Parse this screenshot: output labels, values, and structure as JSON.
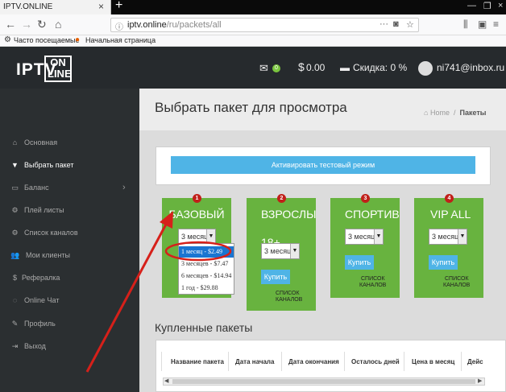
{
  "browser": {
    "tab_title": "IPTV.ONLINE",
    "url_host": "iptv.online",
    "url_path": "/ru/packets/all",
    "bookmarks": [
      "Часто посещаемые",
      "Начальная страница"
    ]
  },
  "header": {
    "logo_main": "IPTV",
    "logo_on": "ON",
    "logo_line": "LINE",
    "mail_count": "0",
    "balance": "0.00",
    "discount": "Скидка: 0 %",
    "email": "ni741@inbox.ru"
  },
  "sidebar": {
    "items": [
      {
        "icon": "home-icon",
        "label": "Основная"
      },
      {
        "icon": "cart-icon",
        "label": "Выбрать пакет"
      },
      {
        "icon": "card-icon",
        "label": "Баланс"
      },
      {
        "icon": "gear-icon",
        "label": "Плей листы"
      },
      {
        "icon": "gear-icon",
        "label": "Список каналов"
      },
      {
        "icon": "users-icon",
        "label": "Мои клиенты"
      },
      {
        "icon": "dollar-icon",
        "label": "Рефералка"
      },
      {
        "icon": "chat-icon",
        "label": "Online Чат"
      },
      {
        "icon": "edit-icon",
        "label": "Профиль"
      },
      {
        "icon": "logout-icon",
        "label": "Выход"
      }
    ]
  },
  "main": {
    "title": "Выбрать пакет для просмотра",
    "breadcrumb_home": "Home",
    "breadcrumb_sep": "/",
    "breadcrumb_current": "Пакеты",
    "test_button": "Активировать тестовый режим",
    "packages": [
      {
        "num": "1",
        "name": "БАЗОВЫЙ",
        "select": "3 месяца",
        "buy": "Купить",
        "channels": "СПИСОК КАНАЛОВ"
      },
      {
        "num": "2",
        "name": "ВЗРОСЛЫЙ",
        "name2": "18+",
        "select": "3 месяца",
        "buy": "Купить",
        "channels1": "СПИСОК",
        "channels2": "КАНАЛОВ"
      },
      {
        "num": "3",
        "name": "СПОРТИВНЫЙ",
        "select": "3 месяца",
        "buy": "Купить",
        "channels1": "СПИСОК",
        "channels2": "КАНАЛОВ"
      },
      {
        "num": "4",
        "name": "VIP ALL",
        "select": "3 месяца",
        "buy": "Купить",
        "channels1": "СПИСОК",
        "channels2": "КАНАЛОВ"
      }
    ],
    "dropdown_options": [
      "1 месяц - $2.49",
      "3 месяцев - $7.47",
      "6 месяцев - $14.94",
      "1 год - $29.88"
    ],
    "bought_title": "Купленные пакеты",
    "table_headers": [
      "Название пакета",
      "Дата начала",
      "Дата окончания",
      "Осталось дней",
      "Цена в месяц",
      "Дейс"
    ]
  }
}
